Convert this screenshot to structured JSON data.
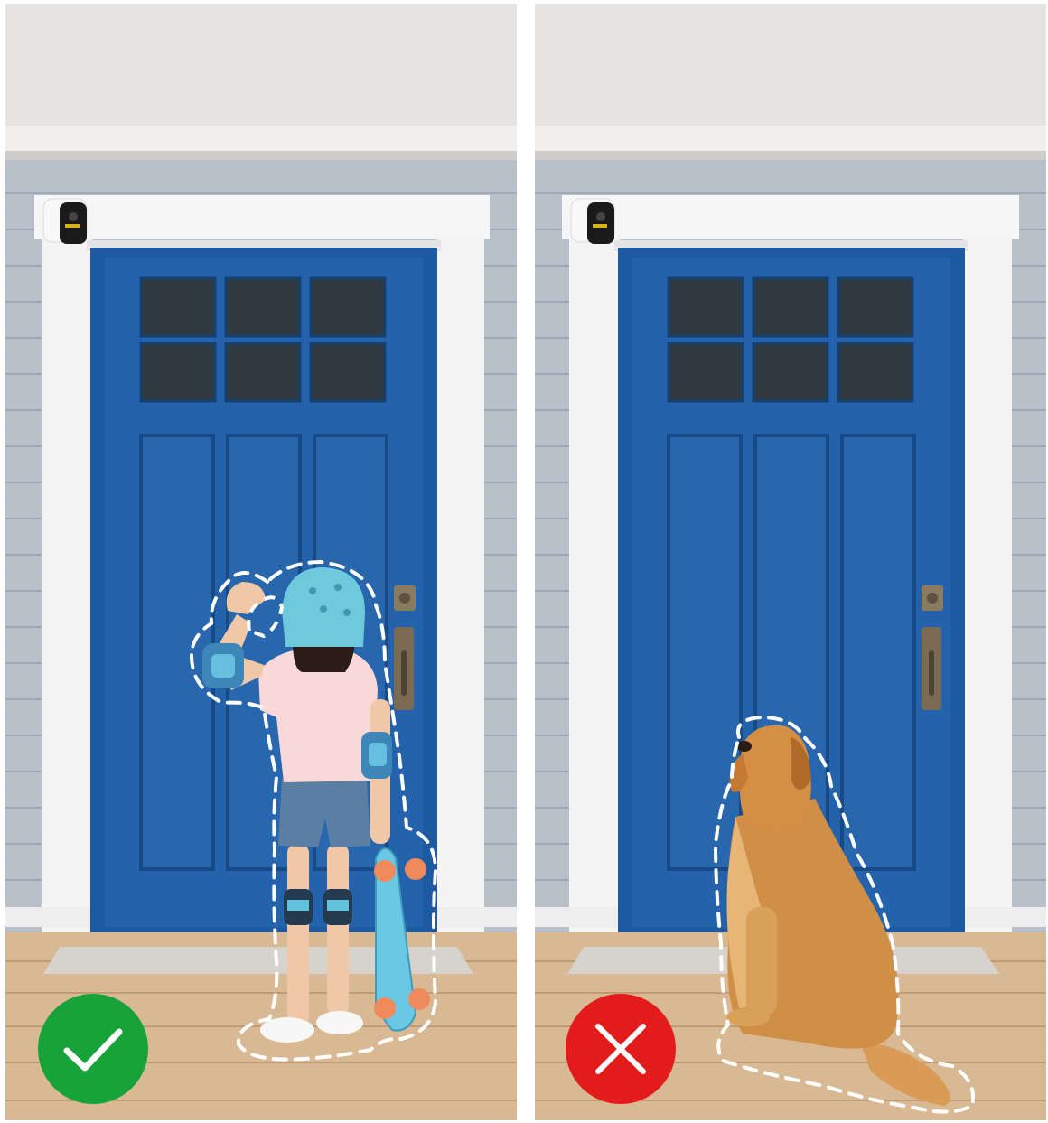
{
  "panels": [
    {
      "id": "allowed",
      "subject": "person",
      "badge_icon": "checkmark-icon",
      "badge_color": "#16a34a"
    },
    {
      "id": "ignored",
      "subject": "pet",
      "badge_icon": "x-mark-icon",
      "badge_color": "#e11d1d"
    }
  ],
  "colors": {
    "ceiling": "#e8e6e4",
    "siding": "#b9c1cb",
    "trim": "#f4f5f6",
    "door": "#1c5aa3",
    "floor": "#d7b792",
    "outline": "#ffffff"
  }
}
